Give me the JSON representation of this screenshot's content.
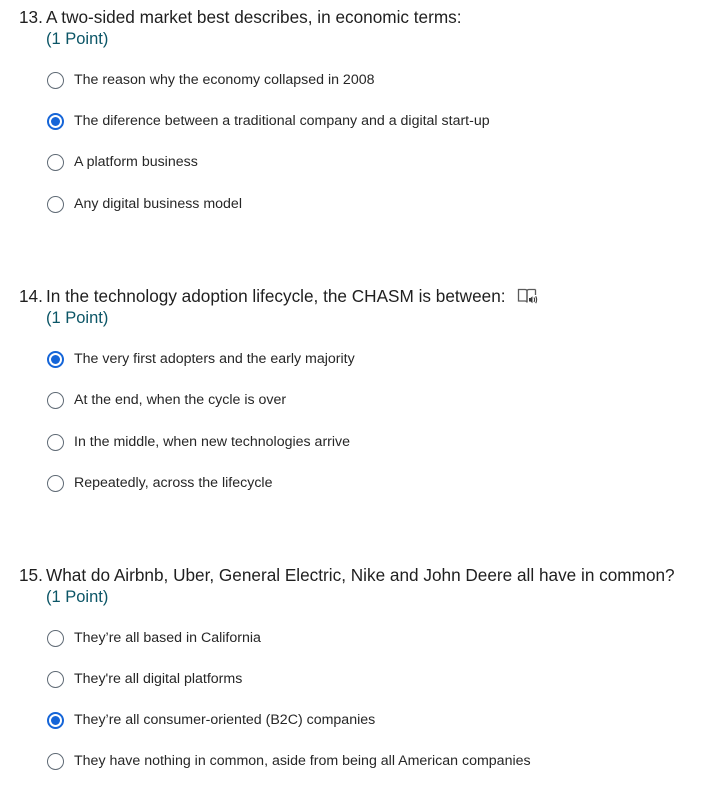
{
  "questions": [
    {
      "number": "13.",
      "text": "A  two-sided market best describes, in economic terms:",
      "points": "(1 Point)",
      "options": [
        {
          "label": "The reason why the economy collapsed in 2008",
          "selected": false
        },
        {
          "label": "The diference between a traditional company and a digital start-up",
          "selected": true
        },
        {
          "label": "A platform business",
          "selected": false
        },
        {
          "label": "Any digital business model",
          "selected": false
        }
      ]
    },
    {
      "number": "14.",
      "text": "In the technology adoption lifecycle, the CHASM is between:",
      "points": "(1 Point)",
      "icon": "immersive-reader-icon",
      "options": [
        {
          "label": "The very first adopters and the early majority",
          "selected": true
        },
        {
          "label": "At the end, when the cycle is over",
          "selected": false
        },
        {
          "label": "In the middle, when new technologies arrive",
          "selected": false
        },
        {
          "label": "Repeatedly, across the lifecycle",
          "selected": false
        }
      ]
    },
    {
      "number": "15.",
      "text": "What do Airbnb, Uber, General Electric, Nike and John Deere all have in common?",
      "points": "(1 Point)",
      "options": [
        {
          "label": "They’re all based in California",
          "selected": false
        },
        {
          "label": "They're all digital platforms",
          "selected": false
        },
        {
          "label": "They’re all consumer-oriented (B2C) companies",
          "selected": true
        },
        {
          "label": "They have nothing in common, aside from being all American companies",
          "selected": false
        }
      ]
    }
  ],
  "colors": {
    "accent": "#1565d8",
    "points_text": "#0b5566",
    "radio_border": "#5f6a75"
  }
}
